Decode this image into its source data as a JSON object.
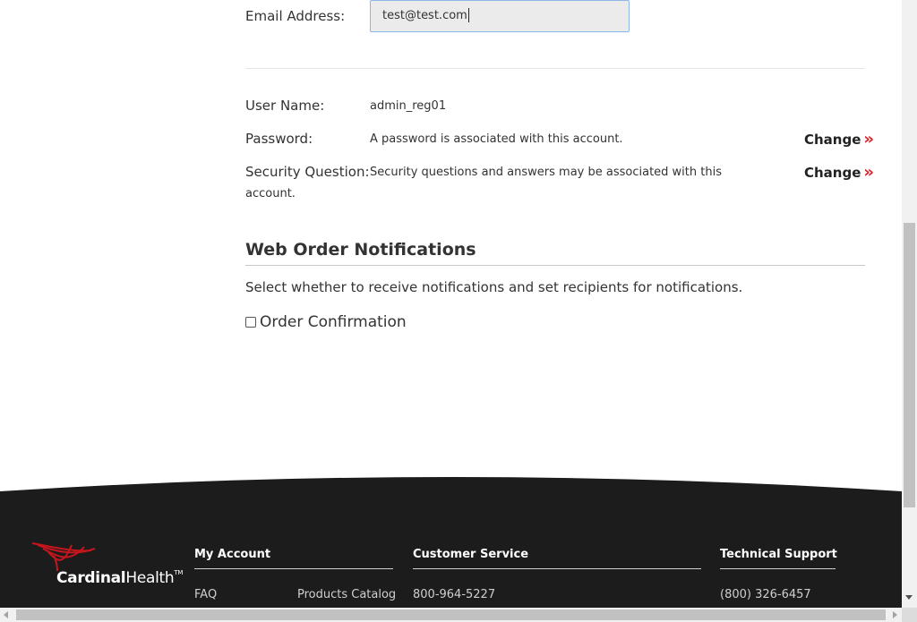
{
  "account": {
    "email_label": "Email Address:",
    "email_value": "test@test.com",
    "username_label": "User Name:",
    "username_value": "admin_reg01",
    "password_label": "Password:",
    "password_value": "A password is associated with this account.",
    "password_change": "Change",
    "security_label": "Security Question:",
    "security_value_line1": "Security questions and answers may be associated with this",
    "security_value_line2": "account.",
    "security_change": "Change",
    "change_arrow": "»"
  },
  "notifications": {
    "title": "Web Order Notifications",
    "description": "Select whether to receive notifications and set recipients for notifications.",
    "order_confirmation_label": "Order Confirmation",
    "order_confirmation_checked": false
  },
  "footer": {
    "logo_name_bold": "Cardinal",
    "logo_name_regular": "Health",
    "logo_tm": "TM",
    "my_account": {
      "title": "My Account",
      "links": [
        "FAQ",
        "Products Catalog"
      ]
    },
    "customer_service": {
      "title": "Customer Service",
      "phone": "800-964-5227"
    },
    "technical_support": {
      "title": "Technical Support",
      "phone": "(800) 326-6457"
    }
  },
  "colors": {
    "accent_red": "#d2232a",
    "footer_bg": "#1c1c1c",
    "input_focus_border": "#8fb6e8"
  }
}
